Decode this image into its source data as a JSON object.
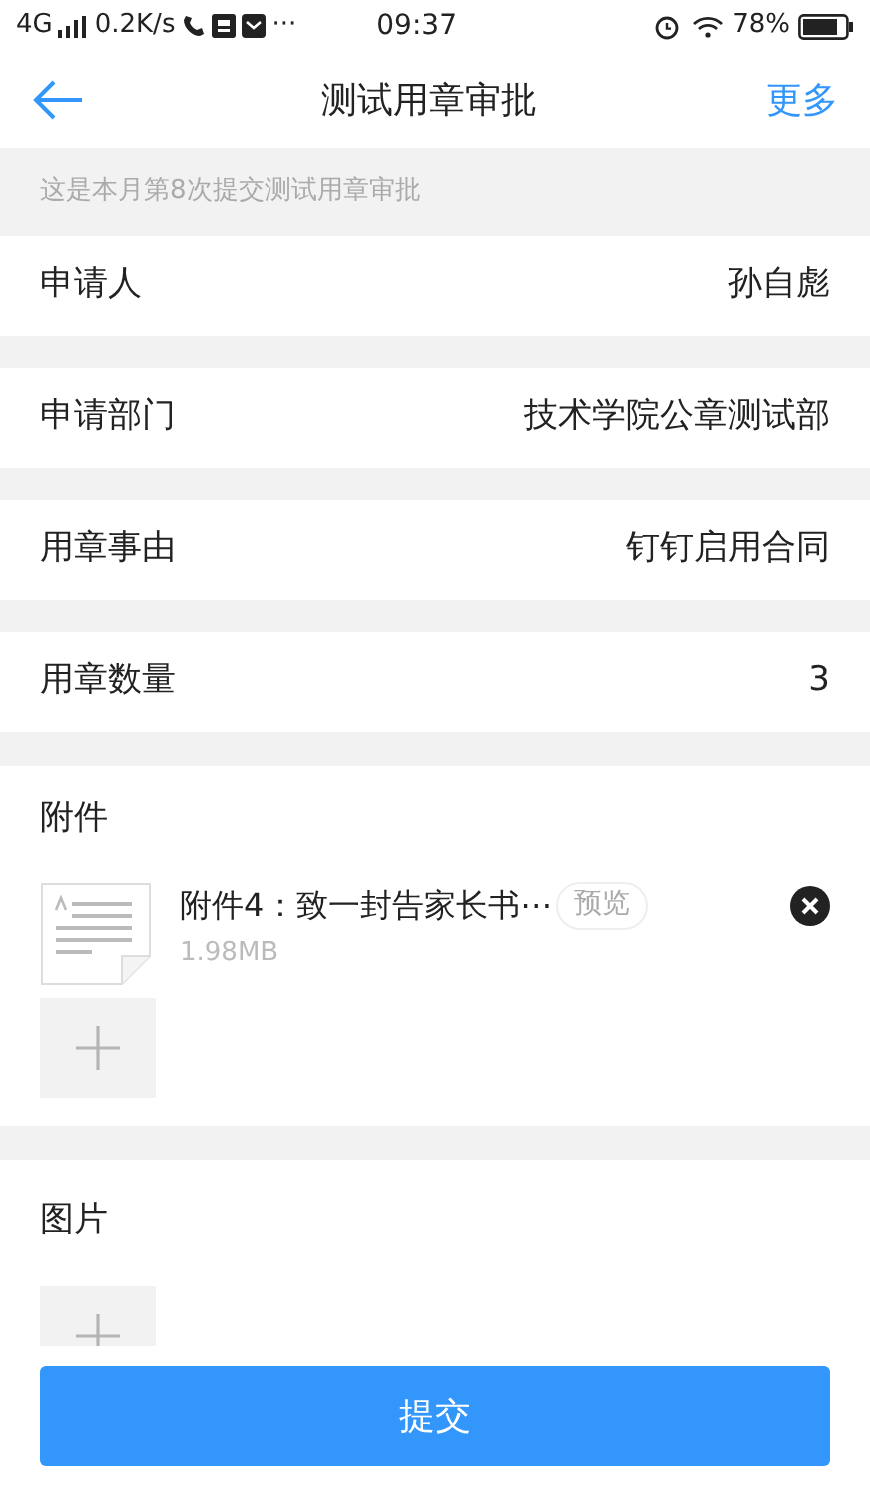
{
  "status_bar": {
    "network": "4G",
    "speed": "0.2K/s",
    "more": "···",
    "time": "09:37",
    "battery": "78%"
  },
  "nav": {
    "title": "测试用章审批",
    "action": "更多"
  },
  "notice": "这是本月第8次提交测试用章审批",
  "fields": [
    {
      "label": "申请人",
      "value": "孙自彪"
    },
    {
      "label": "申请部门",
      "value": "技术学院公章测试部"
    },
    {
      "label": "用章事由",
      "value": "钉钉启用合同"
    },
    {
      "label": "用章数量",
      "value": "3"
    }
  ],
  "attachments": {
    "title": "附件",
    "files": [
      {
        "name": "附件4：致一封告家长书⋯",
        "size": "1.98MB",
        "preview": "预览"
      }
    ]
  },
  "images": {
    "title": "图片"
  },
  "submit": "提交"
}
